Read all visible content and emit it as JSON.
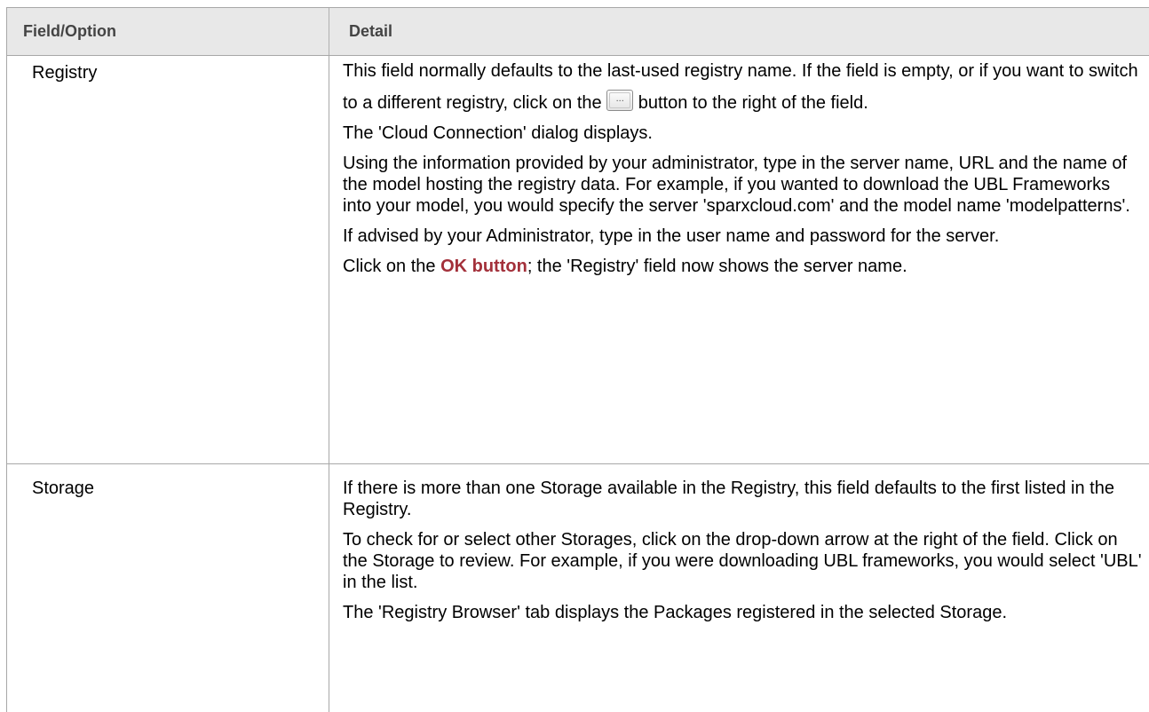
{
  "header": {
    "field_col": "Field/Option",
    "detail_col": "Detail"
  },
  "rows": [
    {
      "field": "Registry",
      "p1_before": "This field normally defaults to the last-used registry name. If the field is empty, or if you want to switch to a different registry, click on the ",
      "p1_button_glyph": "...",
      "p1_after": " button to the right of the field.",
      "p2": "The 'Cloud Connection' dialog displays.",
      "p3": "Using the information provided by your administrator, type in the server name, URL and the name of the model hosting the registry data. For example, if you wanted to download the UBL Frameworks into your model, you would specify the server 'sparxcloud.com' and the model name 'modelpatterns'.",
      "p4": "If advised by your Administrator, type in the user name and password for the server.",
      "p5_before": "Click on the ",
      "p5_link": "OK button",
      "p5_after": "; the 'Registry' field now shows the server name."
    },
    {
      "field": "Storage",
      "p1": "If there is more than one Storage available in the Registry, this field defaults to the first listed in the Registry.",
      "p2": "To check for or select other Storages, click on the drop-down arrow at the right of the field. Click on the Storage to review. For example, if you were downloading UBL frameworks, you would select 'UBL' in the list.",
      "p3": "The 'Registry Browser' tab displays the Packages registered in the selected Storage."
    }
  ],
  "colors": {
    "header_bg": "#e8e8e8",
    "border": "#a8a8a8",
    "link": "#a3303a"
  }
}
